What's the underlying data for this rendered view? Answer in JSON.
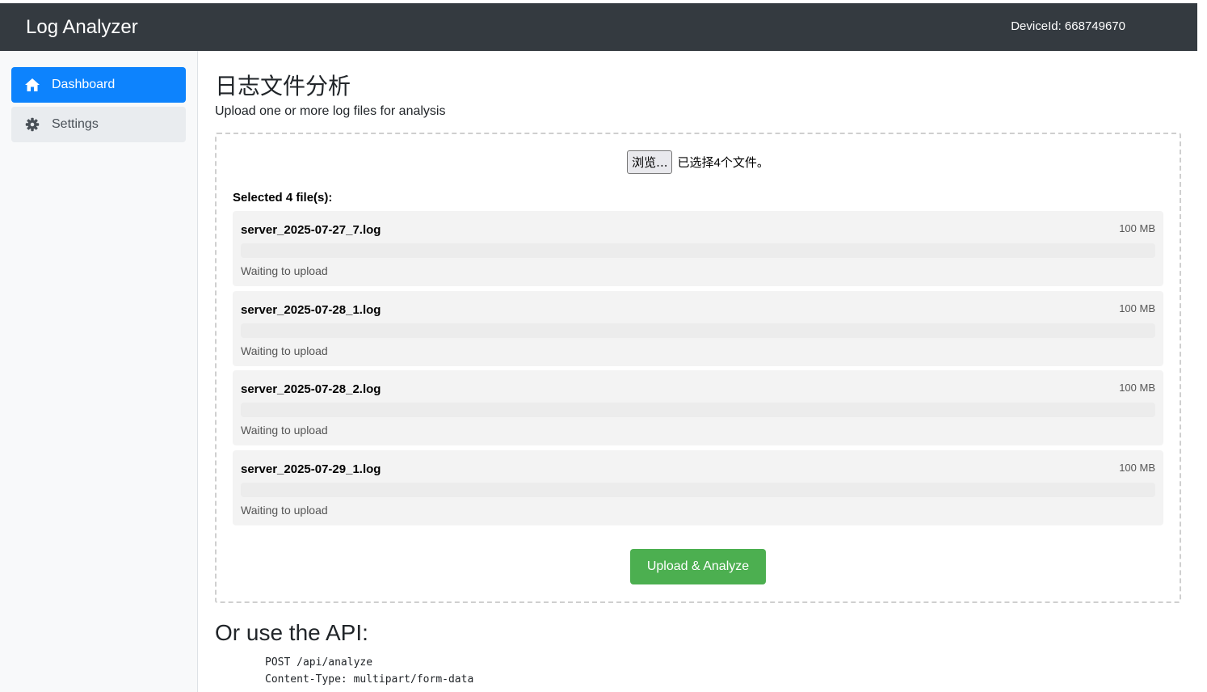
{
  "navbar": {
    "brand": "Log Analyzer",
    "device": "DeviceId: 668749670"
  },
  "sidebar": {
    "items": [
      {
        "label": "Dashboard",
        "icon": "home-icon",
        "active": true
      },
      {
        "label": "Settings",
        "icon": "gear-icon",
        "active": false
      }
    ]
  },
  "main": {
    "title": "日志文件分析",
    "subtitle": "Upload one or more log files for analysis",
    "file_input": {
      "button_label": "浏览...",
      "status": "已选择4个文件。"
    },
    "selected_label": "Selected 4 file(s):",
    "files": [
      {
        "name": "server_2025-07-27_7.log",
        "size": "100 MB",
        "status": "Waiting to upload",
        "progress": 0
      },
      {
        "name": "server_2025-07-28_1.log",
        "size": "100 MB",
        "status": "Waiting to upload",
        "progress": 0
      },
      {
        "name": "server_2025-07-28_2.log",
        "size": "100 MB",
        "status": "Waiting to upload",
        "progress": 0
      },
      {
        "name": "server_2025-07-29_1.log",
        "size": "100 MB",
        "status": "Waiting to upload",
        "progress": 0
      }
    ],
    "upload_button": "Upload & Analyze",
    "api_title": "Or use the API:",
    "api_lines": [
      "POST /api/analyze",
      "Content-Type: multipart/form-data"
    ]
  },
  "colors": {
    "navbar": "#343a40",
    "active": "#0d83fd",
    "upload": "#4caf50"
  }
}
